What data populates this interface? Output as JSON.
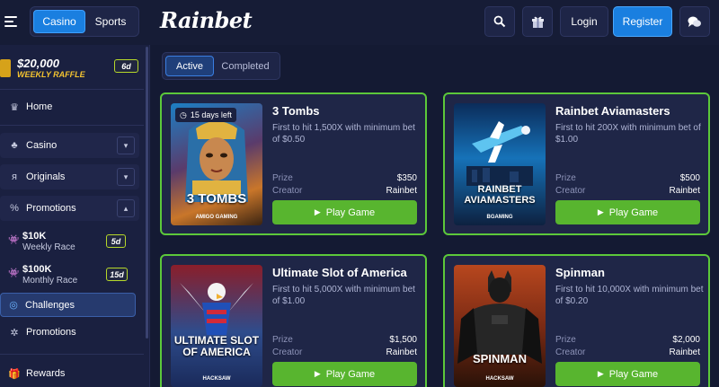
{
  "header": {
    "mode_tabs": [
      "Casino",
      "Sports"
    ],
    "logo": "Rainbet",
    "login": "Login",
    "register": "Register",
    "icons": [
      "search-icon",
      "gift-icon",
      "chat-icon"
    ]
  },
  "sidebar": {
    "raffle": {
      "amount": "$20,000",
      "label": "WEEKLY RAFFLE",
      "badge": "6d"
    },
    "home": "Home",
    "casino": "Casino",
    "originals": "Originals",
    "promotions_group": "Promotions",
    "races": [
      {
        "amount": "$10K",
        "label": "Weekly Race",
        "badge": "5d"
      },
      {
        "amount": "$100K",
        "label": "Monthly Race",
        "badge": "15d"
      }
    ],
    "challenges": "Challenges",
    "promotions": "Promotions",
    "rewards": "Rewards"
  },
  "tabs": {
    "active": "Active",
    "completed": "Completed"
  },
  "labels": {
    "prize": "Prize",
    "creator": "Creator",
    "play": "Play Game"
  },
  "cards": [
    {
      "title": "3 Tombs",
      "description": "First to hit 1,500X with minimum bet of $0.50",
      "prize": "$350",
      "creator": "Rainbet",
      "thumb_title": "3 TOMBS",
      "thumb_provider": "AMIGO GAMING",
      "days_left": "15 days left"
    },
    {
      "title": "Rainbet Aviamasters",
      "description": "First to hit 200X with minimum bet of $1.00",
      "prize": "$500",
      "creator": "Rainbet",
      "thumb_title": "RAINBET AVIAMASTERS",
      "thumb_provider": "BGAMING"
    },
    {
      "title": "Ultimate Slot of America",
      "description": "First to hit 5,000X with minimum bet of $1.00",
      "prize": "$1,500",
      "creator": "Rainbet",
      "thumb_title": "ULTIMATE SLOT OF AMERICA",
      "thumb_provider": "HACKSAW"
    },
    {
      "title": "Spinman",
      "description": "First to hit 10,000X with minimum bet of $0.20",
      "prize": "$2,000",
      "creator": "Rainbet",
      "thumb_title": "SPINMAN",
      "thumb_provider": "HACKSAW"
    }
  ],
  "colors": {
    "accent_blue": "#1a7fe0",
    "card_border": "#5cc83a",
    "play_button": "#58b52f",
    "raffle_gold": "#f4c430"
  }
}
